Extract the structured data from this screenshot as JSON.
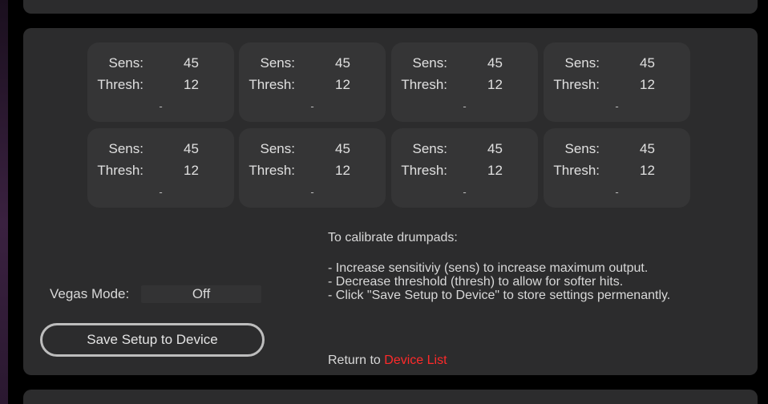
{
  "colors": {
    "background": "#000000",
    "panel": "#2c2c2d",
    "pad": "#353536",
    "text": "#d8d8d8",
    "link": "#ff2a2a",
    "button_border": "#bdbdbd"
  },
  "pads": [
    {
      "sens_label": "Sens:",
      "sens": "45",
      "thresh_label": "Thresh:",
      "thresh": "12",
      "status": "-"
    },
    {
      "sens_label": "Sens:",
      "sens": "45",
      "thresh_label": "Thresh:",
      "thresh": "12",
      "status": "-"
    },
    {
      "sens_label": "Sens:",
      "sens": "45",
      "thresh_label": "Thresh:",
      "thresh": "12",
      "status": "-"
    },
    {
      "sens_label": "Sens:",
      "sens": "45",
      "thresh_label": "Thresh:",
      "thresh": "12",
      "status": "-"
    },
    {
      "sens_label": "Sens:",
      "sens": "45",
      "thresh_label": "Thresh:",
      "thresh": "12",
      "status": "-"
    },
    {
      "sens_label": "Sens:",
      "sens": "45",
      "thresh_label": "Thresh:",
      "thresh": "12",
      "status": "-"
    },
    {
      "sens_label": "Sens:",
      "sens": "45",
      "thresh_label": "Thresh:",
      "thresh": "12",
      "status": "-"
    },
    {
      "sens_label": "Sens:",
      "sens": "45",
      "thresh_label": "Thresh:",
      "thresh": "12",
      "status": "-"
    }
  ],
  "vegas": {
    "label": "Vegas Mode:",
    "value": "Off"
  },
  "save_button": {
    "label": "Save Setup to Device"
  },
  "calibration": {
    "heading": "To calibrate drumpads:",
    "lines": [
      " - Increase sensitiviy (sens) to increase maximum output.",
      " - Decrease threshold (thresh) to allow for softer hits.",
      " - Click \"Save Setup to Device\" to store settings permenantly."
    ]
  },
  "return_nav": {
    "prefix": "Return to ",
    "link_label": "Device List"
  }
}
